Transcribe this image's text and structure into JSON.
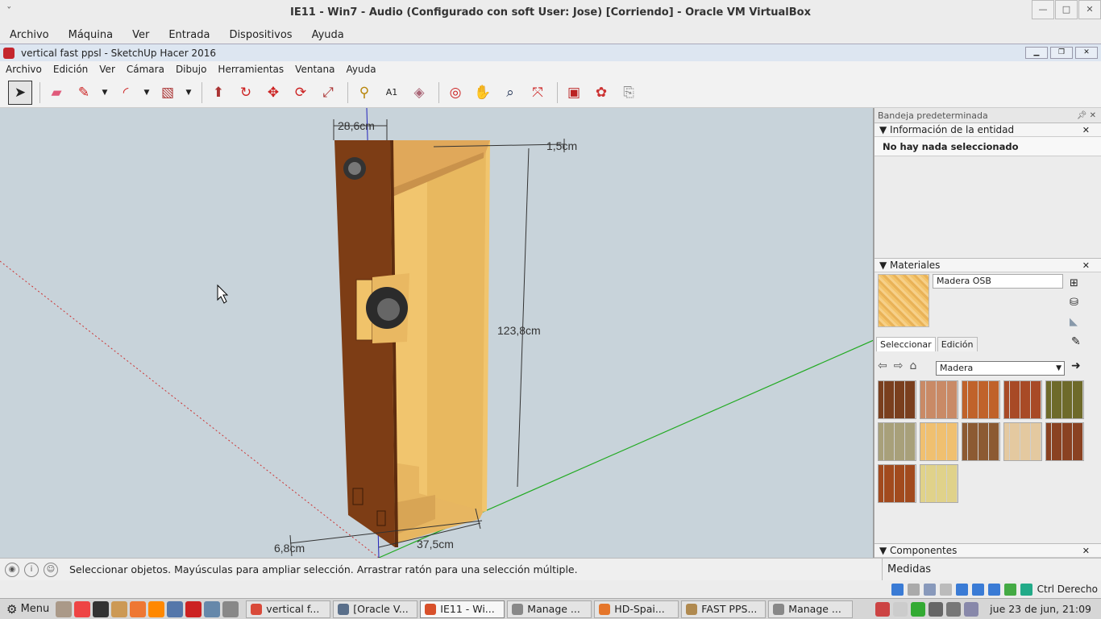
{
  "vbox": {
    "title": "IE11 - Win7 - Audio (Configurado con soft User: Jose) [Corriendo] - Oracle VM VirtualBox",
    "menu": [
      "Archivo",
      "Máquina",
      "Ver",
      "Entrada",
      "Dispositivos",
      "Ayuda"
    ],
    "host_key": "Ctrl Derecho"
  },
  "sketchup": {
    "title": "vertical fast ppsl - SketchUp Hacer 2016",
    "menu": [
      "Archivo",
      "Edición",
      "Ver",
      "Cámara",
      "Dibujo",
      "Herramientas",
      "Ventana",
      "Ayuda"
    ],
    "toolbar": [
      "select-icon",
      "eraser-icon",
      "pencil-icon",
      "arc-icon",
      "rectangle-icon",
      "push-pull-icon",
      "follow-me-icon",
      "move-icon",
      "rotate-icon",
      "scale-icon",
      "tape-measure-icon",
      "text-icon",
      "paint-bucket-icon",
      "orbit-icon",
      "pan-icon",
      "zoom-icon",
      "zoom-extents-icon",
      "warehouse-icon",
      "extension-warehouse-icon",
      "share-model-icon"
    ],
    "dimensions": {
      "width": "28,6cm",
      "top": "1,5cm",
      "height": "123,8cm",
      "depth": "37,5cm",
      "base": "6,8cm"
    },
    "tray": {
      "title": "Bandeja predeterminada",
      "entity_panel": "Información de la entidad",
      "entity_msg": "No hay nada seleccionado",
      "materials_panel": "Materiales",
      "material_name": "Madera OSB",
      "tabs": [
        "Seleccionar",
        "Edición"
      ],
      "library": "Madera",
      "components_panel": "Componentes",
      "swatches": [
        "#7a3f1e",
        "#c98a66",
        "#c0622a",
        "#a84a26",
        "#6e6a2a",
        "#a8a07a",
        "#f0c070",
        "#8c5a32",
        "#e4c9a0",
        "#8a4222",
        "#a24a1e",
        "#e0d28a"
      ]
    },
    "status": {
      "message": "Seleccionar objetos. Mayúsculas para ampliar selección. Arrastrar ratón para una selección múltiple.",
      "measurements": "Medidas"
    }
  },
  "taskbar": {
    "menu": "Menu",
    "tasks": [
      {
        "label": "vertical f...",
        "color": "#d94a3a"
      },
      {
        "label": "[Oracle V...",
        "color": "#5a6f8a"
      },
      {
        "label": "IE11 - Wi...",
        "color": "#d8502a"
      },
      {
        "label": "Manage ...",
        "color": "#888888"
      },
      {
        "label": "HD-Spai...",
        "color": "#e5762b"
      },
      {
        "label": "FAST PPS...",
        "color": "#b08a50"
      },
      {
        "label": "Manage ...",
        "color": "#888888"
      }
    ],
    "clock": "jue 23 de jun, 21:09"
  }
}
